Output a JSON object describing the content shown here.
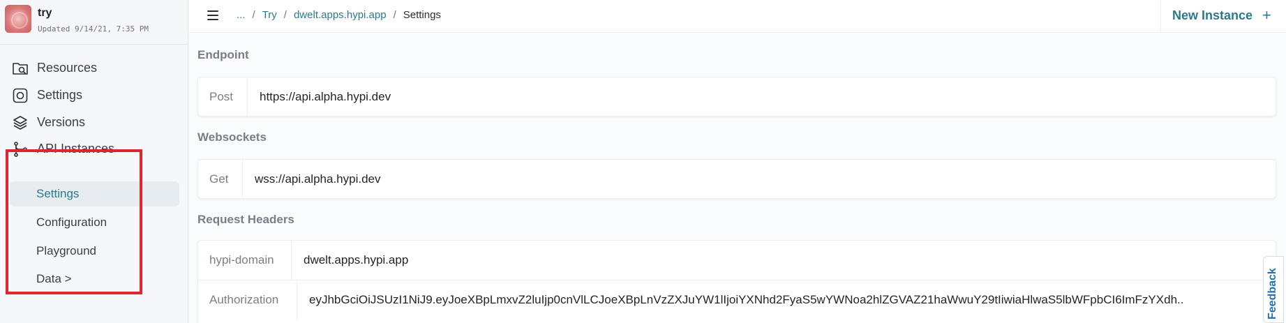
{
  "app": {
    "name": "try",
    "updated": "Updated 9/14/21, 7:35 PM"
  },
  "sidebar": {
    "items": [
      {
        "label": "Resources",
        "icon": "resources-icon"
      },
      {
        "label": "Settings",
        "icon": "settings-icon"
      },
      {
        "label": "Versions",
        "icon": "versions-icon"
      },
      {
        "label": "API Instances",
        "icon": "git-branch-icon"
      }
    ],
    "sub_items": [
      {
        "label": "Settings",
        "active": true
      },
      {
        "label": "Configuration",
        "active": false
      },
      {
        "label": "Playground",
        "active": false
      },
      {
        "label": "Data >",
        "active": false
      }
    ]
  },
  "breadcrumb": {
    "ellipsis": "...",
    "sep": "/",
    "items": [
      "Try",
      "dwelt.apps.hypi.app"
    ],
    "current": "Settings"
  },
  "toolbar": {
    "new_instance": "New Instance",
    "plus": "+"
  },
  "endpoint": {
    "title": "Endpoint",
    "method": "Post",
    "url": "https://api.alpha.hypi.dev"
  },
  "websockets": {
    "title": "Websockets",
    "method": "Get",
    "url": "wss://api.alpha.hypi.dev"
  },
  "request_headers": {
    "title": "Request Headers",
    "rows": [
      {
        "key": "hypi-domain",
        "value": "dwelt.apps.hypi.app"
      },
      {
        "key": "Authorization",
        "value": "eyJhbGciOiJSUzI1NiJ9.eyJoeXBpLmxvZ2luIjp0cnVlLCJoeXBpLnVzZXJuYW1lIjoiYXNhd2FyaS5wYWNoa2hlZGVAZ21haWwuY29tIiwiaHlwaS5lbWFpbCI6ImFzYXdh.."
      }
    ]
  },
  "feedback": {
    "label": "Feedback"
  },
  "colors": {
    "accent": "#2b7a8a",
    "highlight": "#e0252c",
    "feedback": "#1f6fb8"
  }
}
